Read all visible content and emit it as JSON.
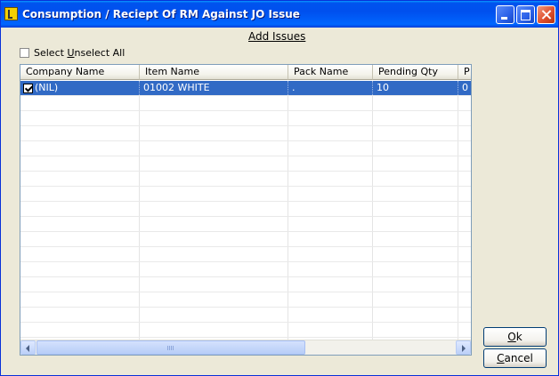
{
  "window": {
    "title": "Consumption / Reciept Of RM Against JO Issue"
  },
  "heading": "Add Issues",
  "select_all": {
    "pre": "Select ",
    "u": "U",
    "post": "nselect All",
    "checked": false
  },
  "columns": [
    "Company Name",
    "Item Name",
    "Pack Name",
    "Pending Qty",
    "P"
  ],
  "rows": [
    {
      "checked": true,
      "company": "(NIL)",
      "item": "01002 WHITE",
      "pack": ".",
      "pending_qty": "10",
      "next": "0",
      "selected": true
    }
  ],
  "buttons": {
    "ok": {
      "u": "O",
      "rest": "k"
    },
    "cancel": {
      "pre": "",
      "u": "C",
      "rest": "ancel"
    }
  }
}
